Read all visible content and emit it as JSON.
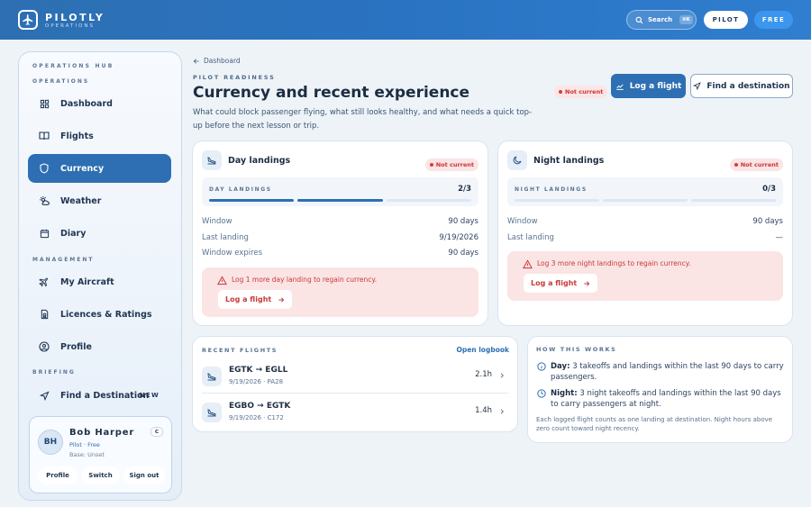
{
  "brand": {
    "name": "PILOTLY",
    "sub": "OPERATIONS"
  },
  "topbar": {
    "search_label": "Search",
    "search_kbd": "⌘K",
    "pilot_label": "PILOT",
    "free_label": "FREE"
  },
  "sidebar": {
    "hub_title": "OPERATIONS HUB",
    "section_operations": "OPERATIONS",
    "section_management": "MANAGEMENT",
    "section_briefing": "BRIEFING",
    "items": [
      {
        "label": "Dashboard",
        "icon": "dashboard-icon"
      },
      {
        "label": "Flights",
        "icon": "book-icon"
      },
      {
        "label": "Currency",
        "icon": "shield-icon"
      },
      {
        "label": "Weather",
        "icon": "weather-icon"
      },
      {
        "label": "Diary",
        "icon": "calendar-icon"
      },
      {
        "label": "My Aircraft",
        "icon": "plane-icon"
      },
      {
        "label": "Licences & Ratings",
        "icon": "licence-icon"
      },
      {
        "label": "Profile",
        "icon": "user-icon"
      },
      {
        "label": "Find a Destination",
        "icon": "navigation-icon"
      }
    ],
    "new_badge": "NEW",
    "user": {
      "initials": "BH",
      "name": "Bob Harper",
      "role": "Pilot · Free",
      "base": "Base: Unset",
      "chip": "C",
      "profile_btn": "Profile",
      "switch_btn": "Switch",
      "signout_btn": "Sign out"
    }
  },
  "header": {
    "breadcrumb": "Dashboard",
    "eyebrow": "PILOT READINESS",
    "title": "Currency and recent experience",
    "description": "What could block passenger flying, what still looks healthy, and what needs a quick top-up before the next lesson or trip.",
    "status": "Not current",
    "log_flight": "Log a flight",
    "find_destination": "Find a destination"
  },
  "day_card": {
    "title": "Day landings",
    "status": "Not current",
    "progress_label": "DAY LANDINGS",
    "progress_value": "2/3",
    "progress_done": 2,
    "progress_total": 3,
    "rows": [
      {
        "label": "Window",
        "value": "90 days"
      },
      {
        "label": "Last landing",
        "value": "9/19/2026"
      },
      {
        "label": "Window expires",
        "value": "90 days"
      }
    ],
    "warning": "Log 1 more day landing to regain currency.",
    "action": "Log a flight"
  },
  "night_card": {
    "title": "Night landings",
    "status": "Not current",
    "progress_label": "NIGHT LANDINGS",
    "progress_value": "0/3",
    "progress_done": 0,
    "progress_total": 3,
    "rows": [
      {
        "label": "Window",
        "value": "90 days"
      },
      {
        "label": "Last landing",
        "value": "—"
      }
    ],
    "warning": "Log 3 more night landings to regain currency.",
    "action": "Log a flight"
  },
  "recent": {
    "heading": "RECENT FLIGHTS",
    "link": "Open logbook",
    "flights": [
      {
        "route": "EGTK → EGLL",
        "meta": "9/19/2026 · PA28",
        "duration": "2.1h"
      },
      {
        "route": "EGBO → EGTK",
        "meta": "9/19/2026 · C172",
        "duration": "1.4h"
      }
    ]
  },
  "how": {
    "heading": "HOW THIS WORKS",
    "day_label": "Day:",
    "day_text": "3 takeoffs and landings within the last 90 days to carry passengers.",
    "night_label": "Night:",
    "night_text": "3 night takeoffs and landings within the last 90 days to carry passengers at night.",
    "note": "Each logged flight counts as one landing at destination. Night hours above zero count toward night recency."
  },
  "colors": {
    "accent": "#2d6fb2",
    "danger": "#c9343a",
    "danger_bg": "#fbe4e4",
    "free_pill": "#3d96ee"
  }
}
